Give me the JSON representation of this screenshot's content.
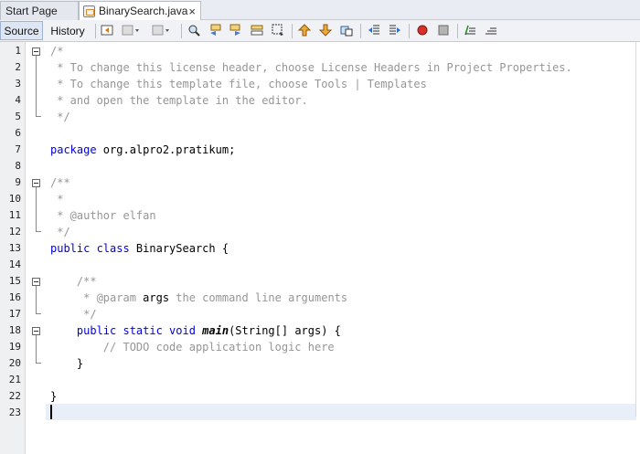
{
  "tabs": [
    {
      "label": "Start Page"
    },
    {
      "label": "BinarySearch.java",
      "close": "×"
    }
  ],
  "toolbar": {
    "source_label": "Source",
    "history_label": "History"
  },
  "line_numbers": [
    "1",
    "2",
    "3",
    "4",
    "5",
    "6",
    "7",
    "8",
    "9",
    "10",
    "11",
    "12",
    "13",
    "14",
    "15",
    "16",
    "17",
    "18",
    "19",
    "20",
    "21",
    "22",
    "23"
  ],
  "code": {
    "l1": "/*",
    "l2": " * To change this license header, choose License Headers in Project Properties.",
    "l3": " * To change this template file, choose Tools | Templates",
    "l4": " * and open the template in the editor.",
    "l5": " */",
    "l7_kw": "package",
    "l7_rest": " org.alpro2.pratikum;",
    "l9": "/**",
    "l10": " *",
    "l11": " * @author elfan",
    "l12": " */",
    "l13_kw": "public class",
    "l13_rest": " BinarySearch {",
    "l15": "    /**",
    "l16_a": "     * @param ",
    "l16_b": "args",
    "l16_c": " the command line arguments",
    "l17": "     */",
    "l18_kw": "    public static void ",
    "l18_main": "main",
    "l18_rest": "(String[] args) {",
    "l19": "        // TODO code application logic here",
    "l20": "    }",
    "l22": "}"
  },
  "icons": [
    "back-icon",
    "forward-dropdown-icon",
    "last-edit-icon",
    "find-icon",
    "find-previous-icon",
    "find-next-icon",
    "toggle-highlight-icon",
    "toggle-rect-select-icon",
    "previous-bookmark-icon",
    "next-bookmark-icon",
    "toggle-bookmark-icon",
    "shift-left-icon",
    "shift-right-icon",
    "start-macro-icon",
    "stop-macro-icon",
    "comment-icon",
    "uncomment-icon"
  ]
}
